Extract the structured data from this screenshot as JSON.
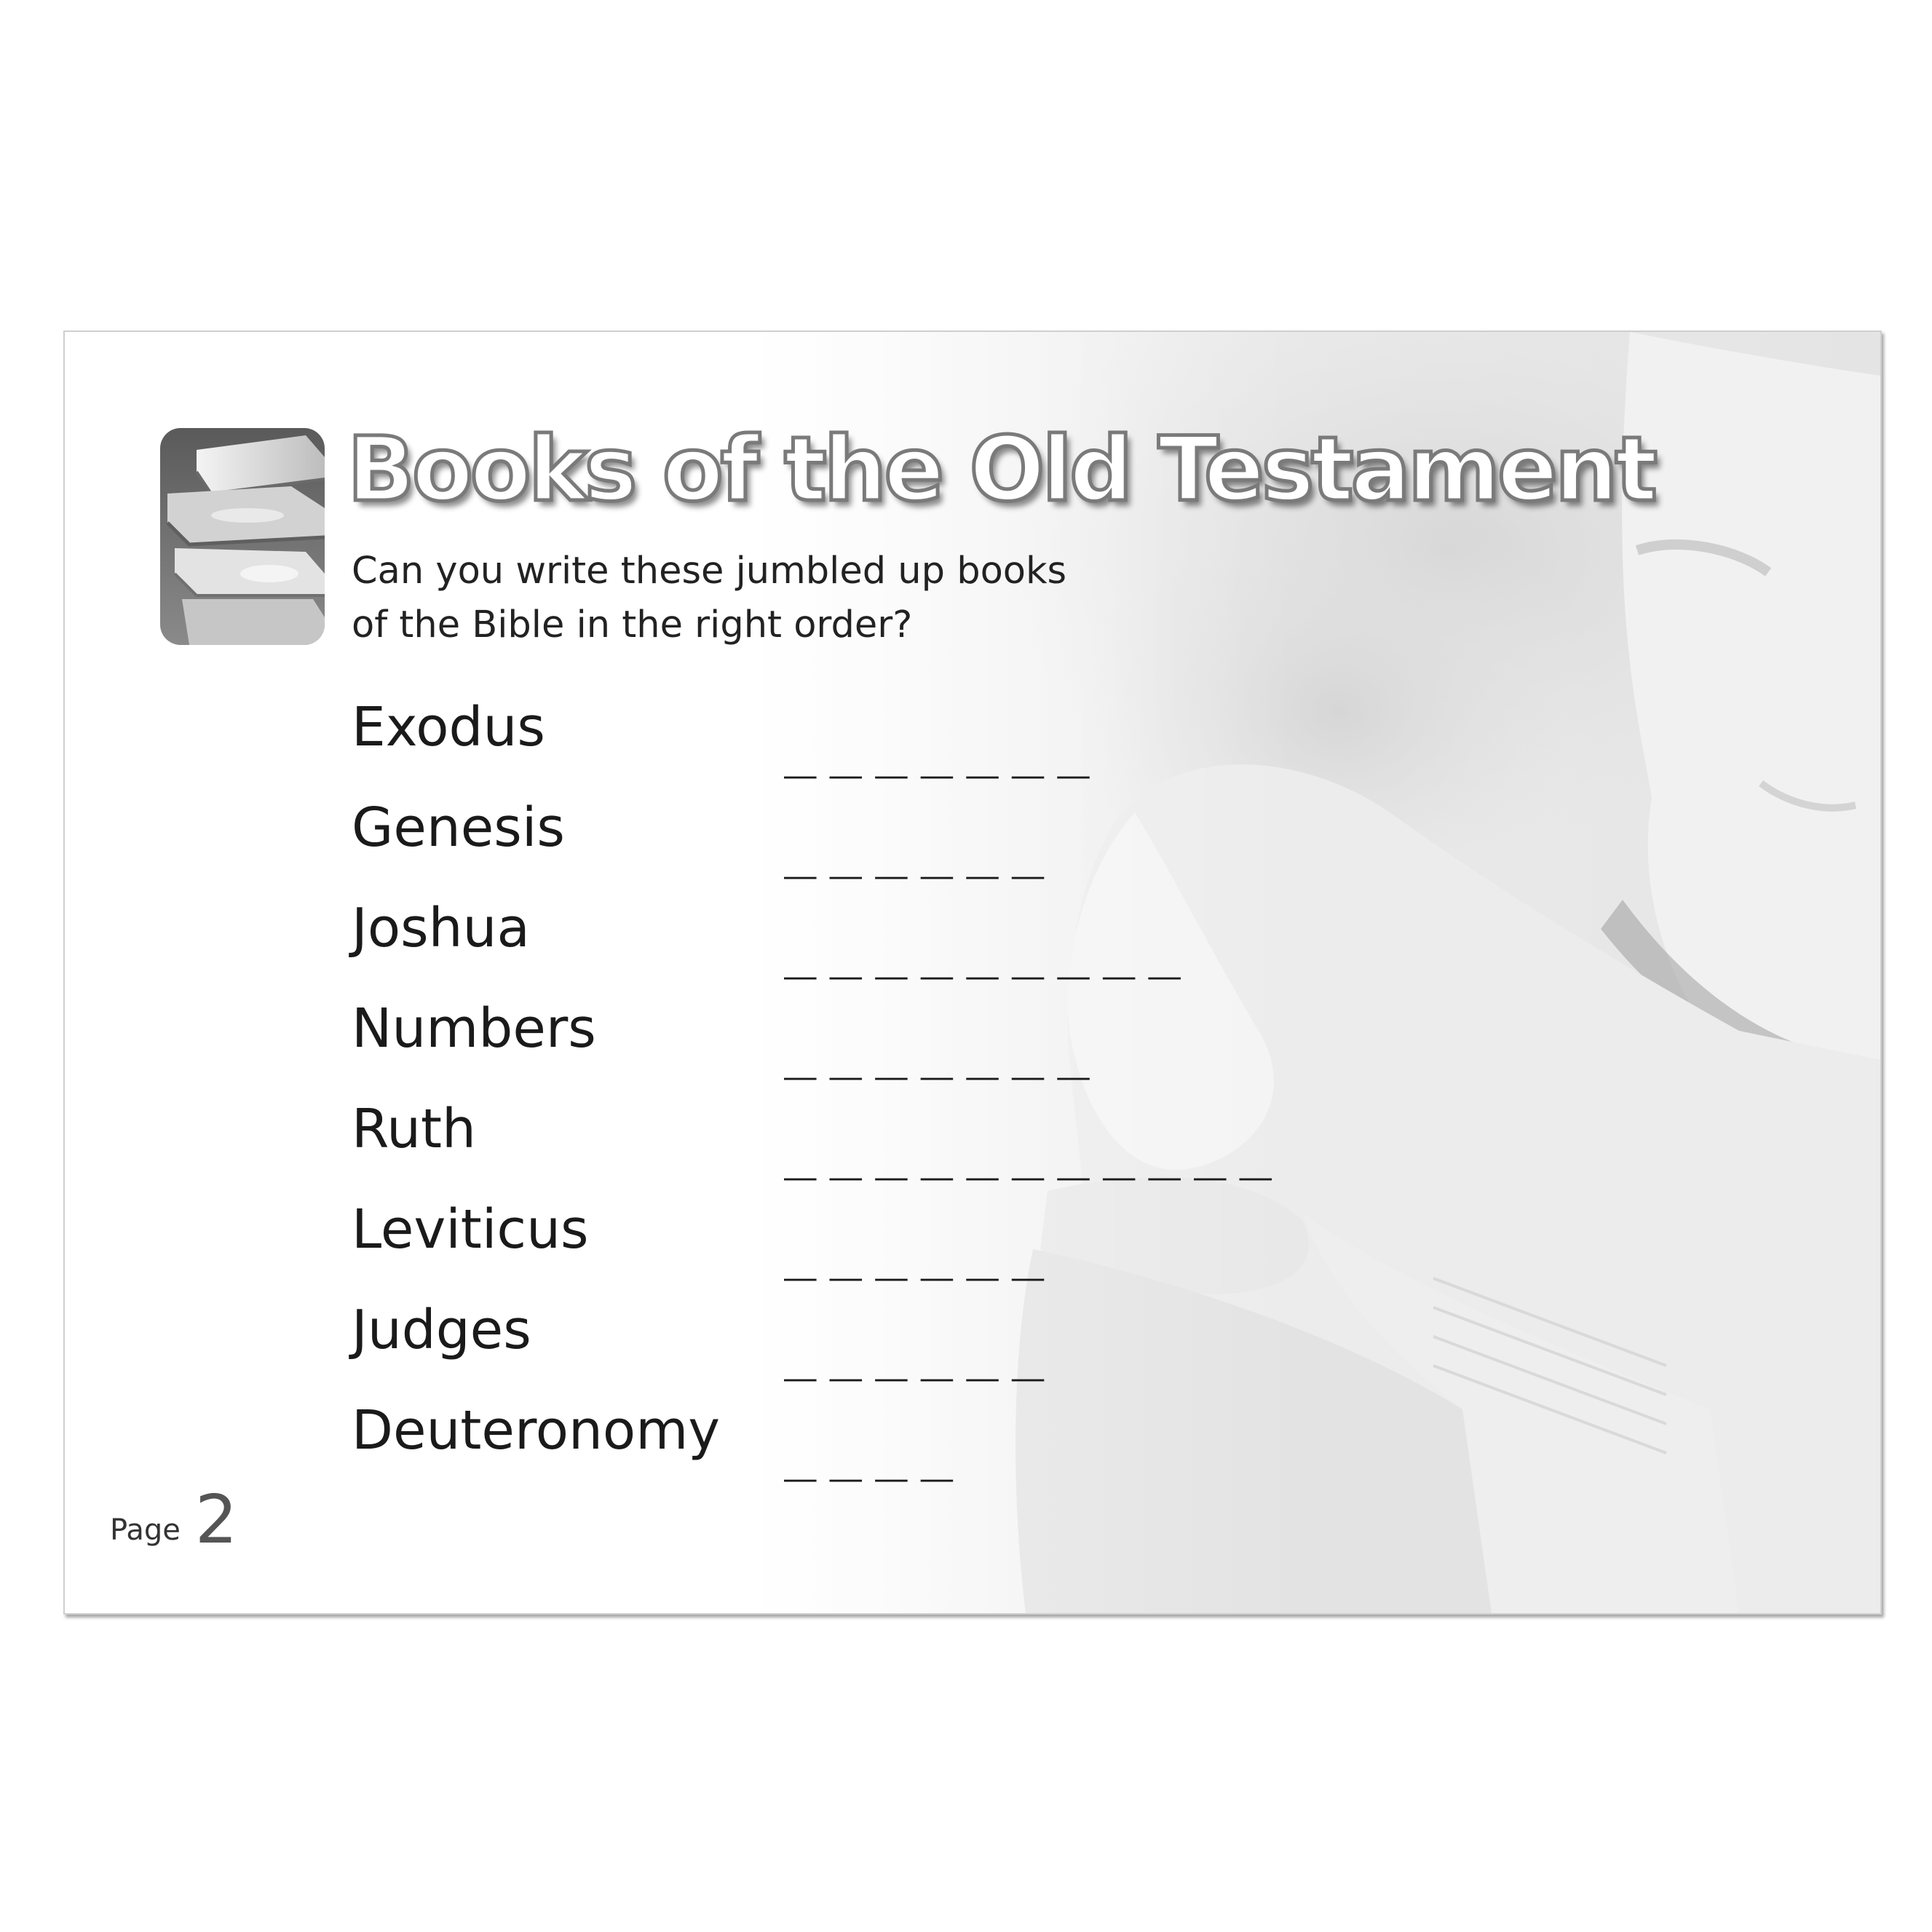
{
  "title": "Books of the Old Testament",
  "subtitle_lines": [
    "Can you write these jumbled up books",
    "of the Bible in the right order?"
  ],
  "books": [
    {
      "name": "Exodus",
      "blanks": "_______"
    },
    {
      "name": "Genesis",
      "blanks": "______"
    },
    {
      "name": "Joshua",
      "blanks": "_________"
    },
    {
      "name": "Numbers",
      "blanks": "_______"
    },
    {
      "name": "Ruth",
      "blanks": "___________"
    },
    {
      "name": "Leviticus",
      "blanks": "______"
    },
    {
      "name": "Judges",
      "blanks": "______"
    },
    {
      "name": "Deuteronomy",
      "blanks": "____"
    }
  ],
  "footer": {
    "page_label": "Page",
    "page_number": "2"
  },
  "images": {
    "header_icon": "stack-of-books-icon",
    "background": "child-reading-book-photo"
  },
  "colors": {
    "text": "#1a1a1a",
    "title_fill": "#ffffff",
    "title_outline": "#7a7a7a",
    "border": "#cfcfcf"
  }
}
